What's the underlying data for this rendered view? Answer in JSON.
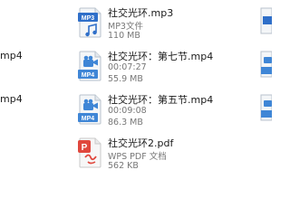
{
  "left_fragments": [
    "mp4",
    "mp4"
  ],
  "files": [
    {
      "name": "社交光环.mp3",
      "line1": "MP3文件",
      "line2": "110 MB",
      "icon": "audio-icon",
      "badge": "MP3"
    },
    {
      "name": "社交光环：第七节.mp4",
      "line1": "00:07:27",
      "line2": "55.9 MB",
      "icon": "video-icon",
      "badge": "MP4"
    },
    {
      "name": "社交光环：第五节.mp4",
      "line1": "00:09:08",
      "line2": "86.3 MB",
      "icon": "video-icon",
      "badge": "MP4"
    },
    {
      "name": "社交光环2.pdf",
      "line1": "WPS PDF 文档",
      "line2": "562 KB",
      "icon": "pdf-icon",
      "badge": "P"
    }
  ],
  "colors": {
    "mp3": "#2f6fc9",
    "mp4": "#3f86d6",
    "pdf": "#e0473d"
  }
}
